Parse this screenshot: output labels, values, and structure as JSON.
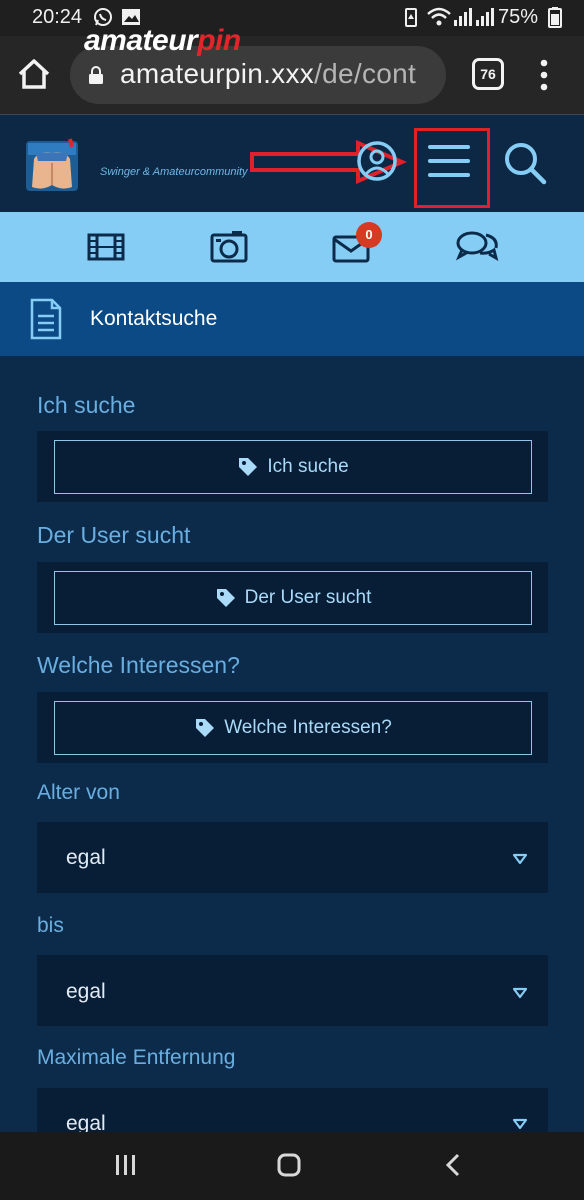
{
  "status_bar": {
    "time": "20:24",
    "battery": "75%",
    "icons": [
      "whatsapp-icon",
      "gallery-icon",
      "battery-saver-icon",
      "wifi-icon",
      "signal-icon",
      "battery-icon"
    ]
  },
  "browser": {
    "url_host": "amateurpin.xxx",
    "url_path": "/de/cont",
    "tab_count": "76"
  },
  "site": {
    "logo_title_a": "amateur",
    "logo_title_b": "pin",
    "logo_subtitle": "Swinger & Amateurcommunity",
    "colors": {
      "accent": "#86cdf6",
      "brand_red": "#e0252b",
      "header_bg": "#0d2845"
    }
  },
  "nav": {
    "items": [
      "video-icon",
      "camera-icon",
      "mail-icon",
      "chat-icon"
    ],
    "mail_badge": "0"
  },
  "section": {
    "title": "Kontaktsuche"
  },
  "form": {
    "fields": [
      {
        "label": "Ich suche",
        "button": "Ich suche"
      },
      {
        "label": "Der User sucht",
        "button": "Der User sucht"
      },
      {
        "label": "Welche Interessen?",
        "button": "Welche Interessen?"
      }
    ],
    "selects": [
      {
        "label": "Alter von",
        "value": "egal"
      },
      {
        "label": "bis",
        "value": "egal"
      },
      {
        "label": "Maximale Entfernung",
        "value": "egal"
      }
    ]
  }
}
